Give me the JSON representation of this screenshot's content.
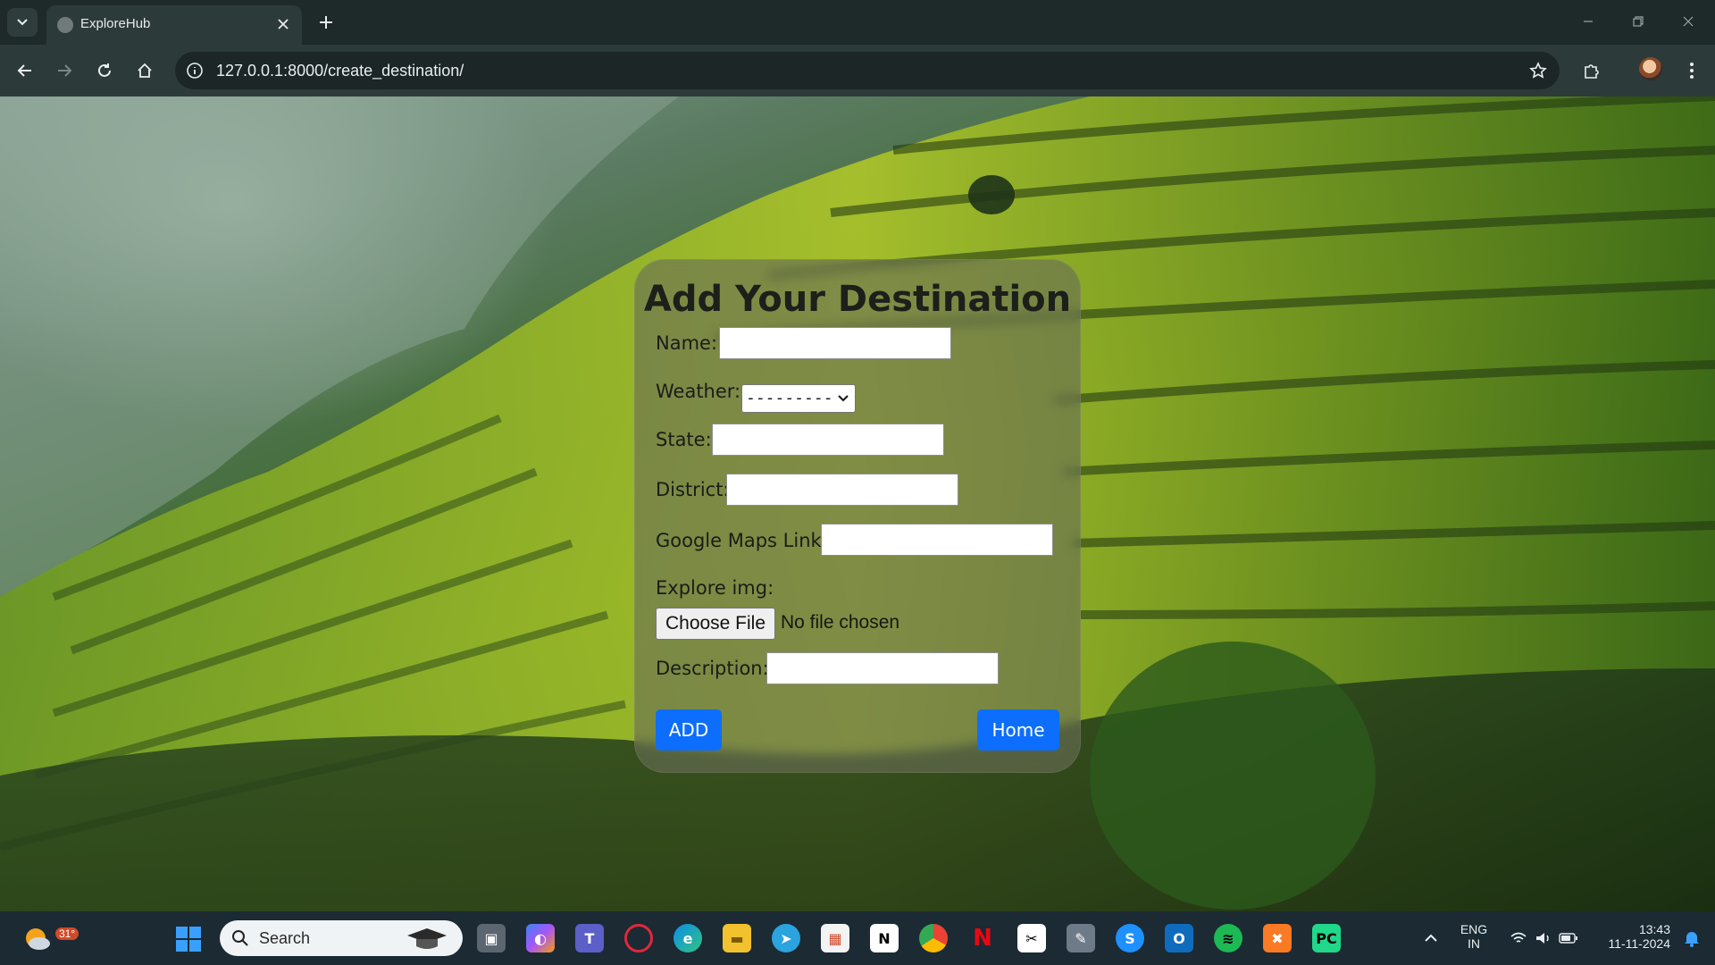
{
  "browser": {
    "tab_title": "ExploreHub",
    "url": "127.0.0.1:8000/create_destination/"
  },
  "form": {
    "title": "Add Your Destination",
    "name_label": "Name:",
    "weather_label": "Weather:",
    "weather_selected": "---------",
    "state_label": "State:",
    "district_label": "District:",
    "maps_label": "Google Maps Link:",
    "img_label": "Explore img:",
    "choose_file": "Choose File",
    "file_status": "No file chosen",
    "description_label": "Description:",
    "add_button": "ADD",
    "home_button": "Home",
    "button_color": "#0d6efd"
  },
  "taskbar": {
    "weather_temp": "31°",
    "search_placeholder": "Search",
    "lang_line1": "ENG",
    "lang_line2": "IN",
    "time": "13:43",
    "date": "11-11-2024"
  }
}
